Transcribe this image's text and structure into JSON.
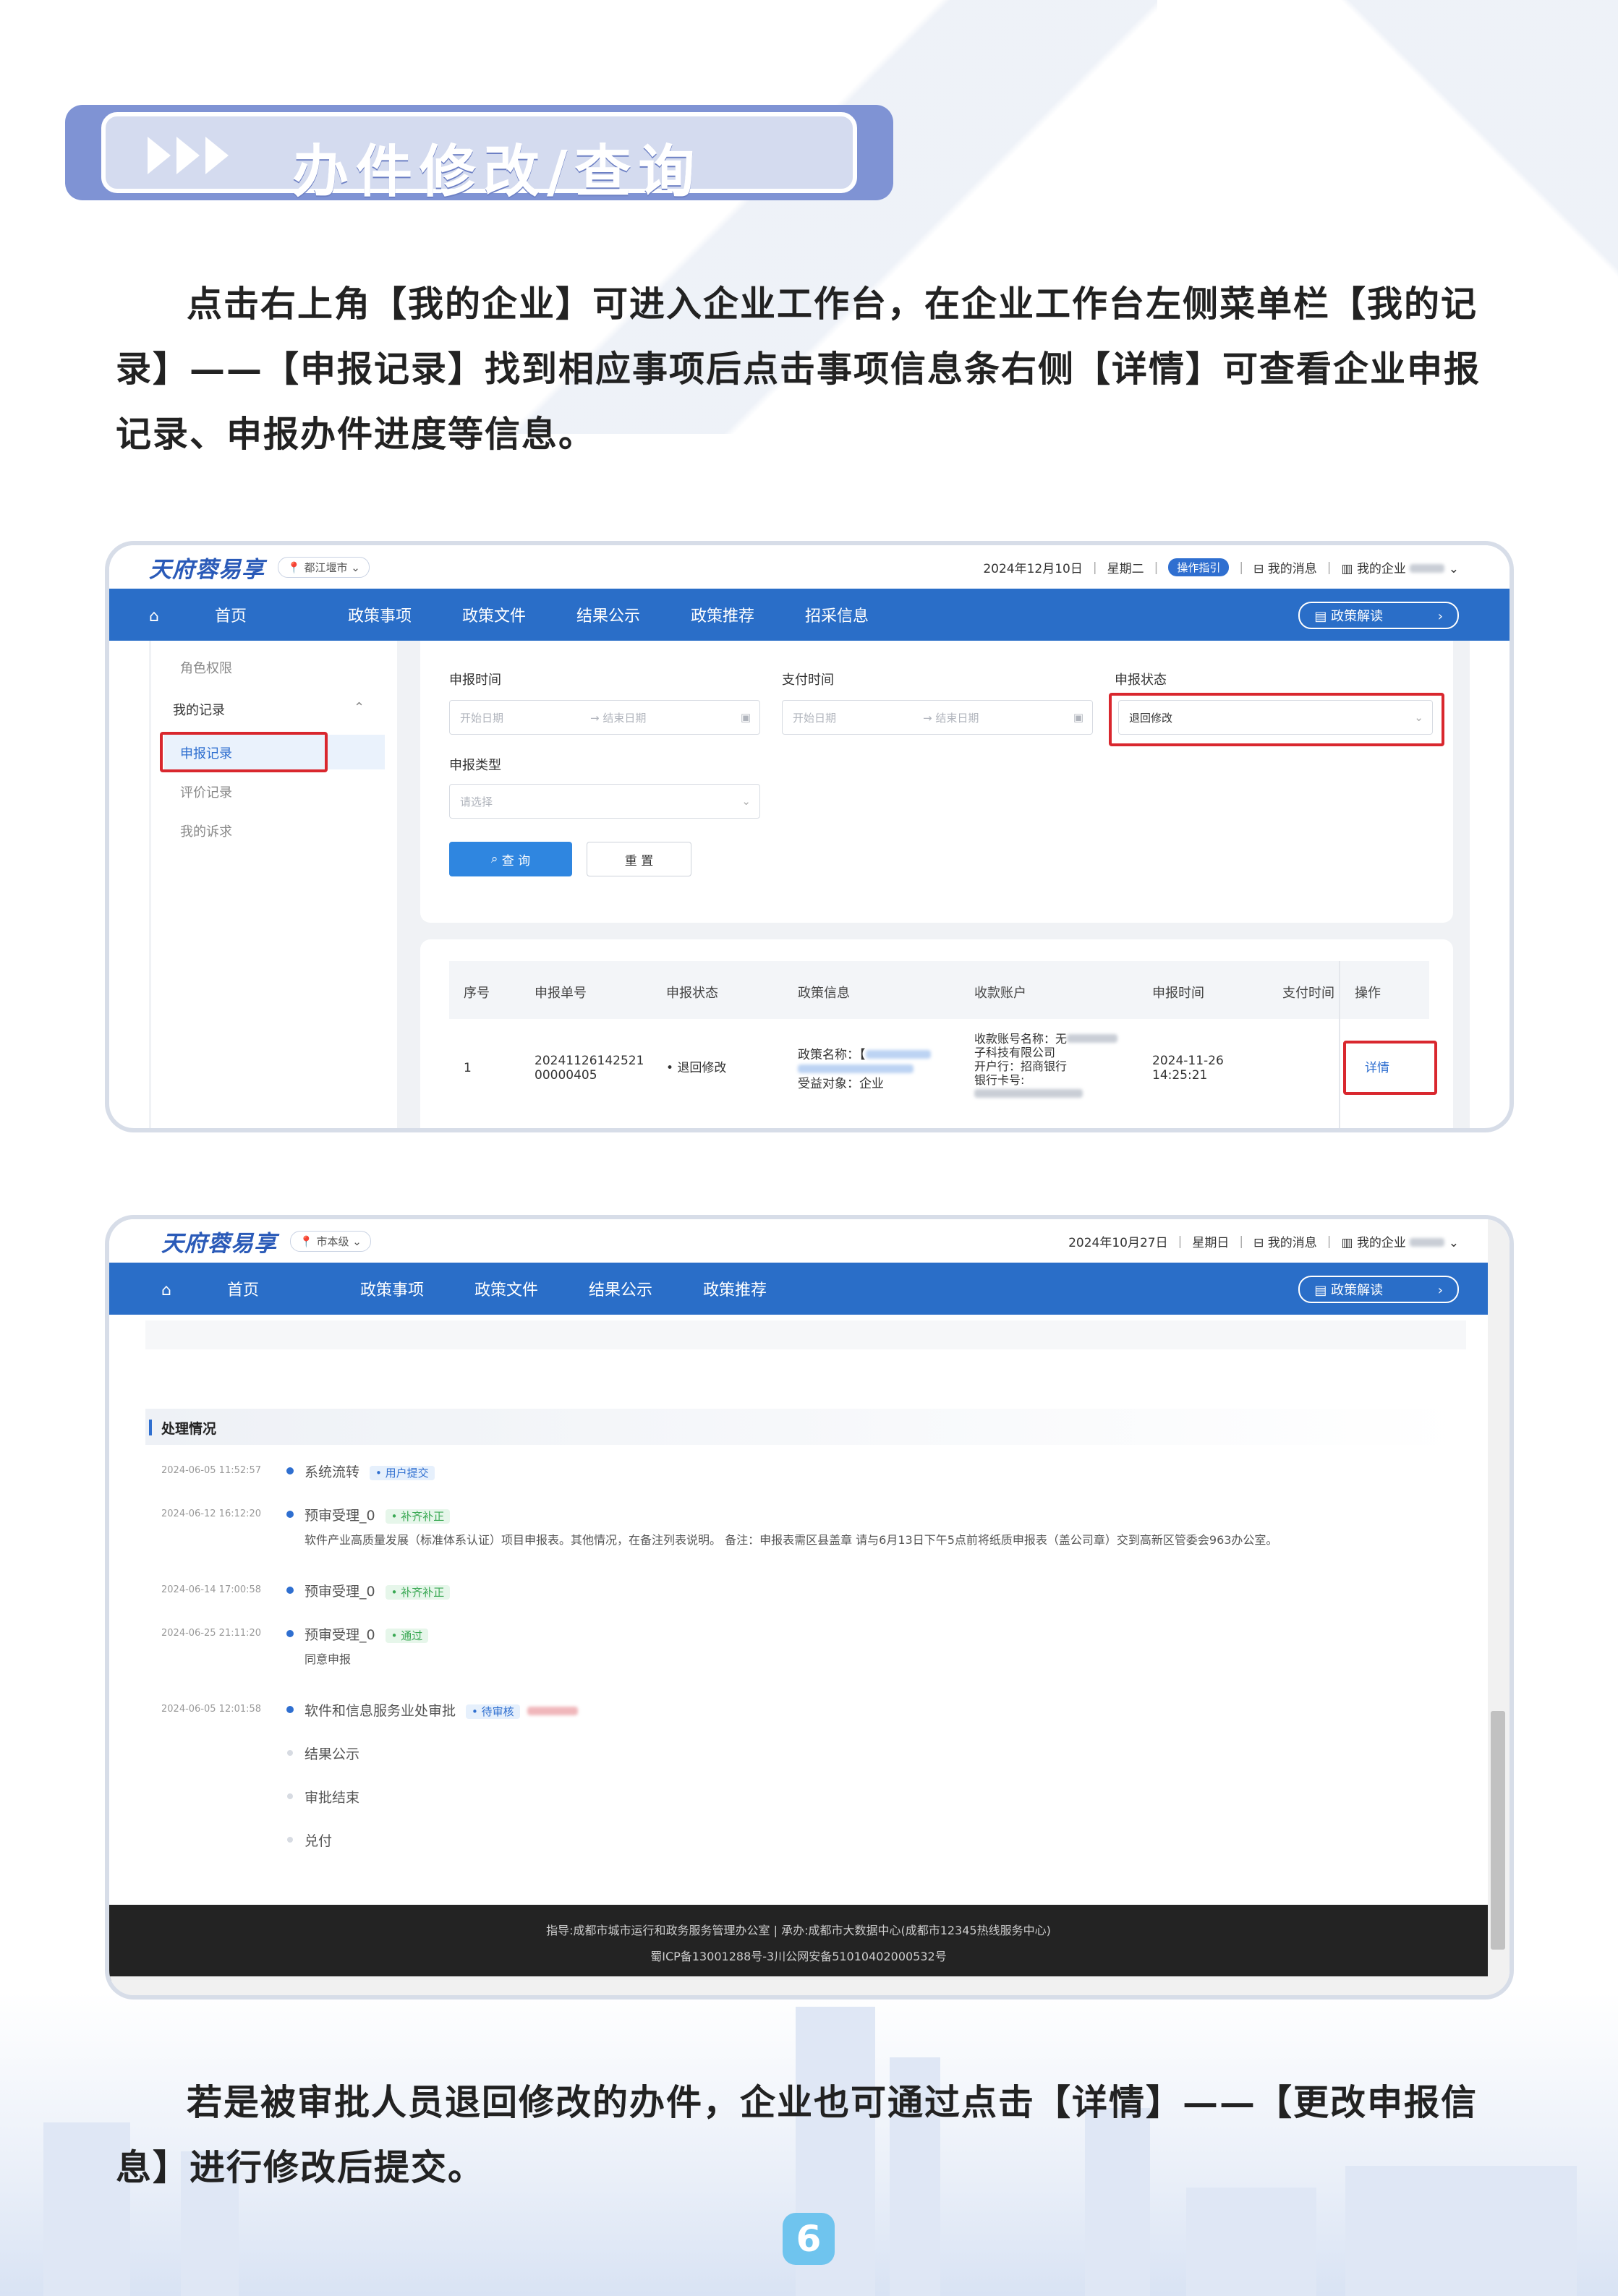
{
  "heading": {
    "title": "办件修改/查询"
  },
  "intro_paragraph": "点击右上角【我的企业】可进入企业工作台，在企业工作台左侧菜单栏【我的记录】——【申报记录】找到相应事项后点击事项信息条右侧【详情】可查看企业申报记录、申报办件进度等信息。",
  "closing_paragraph": "若是被审批人员退回修改的办件，企业也可通过点击【详情】——【更改申报信息】进行修改后提交。",
  "page_number": "6",
  "shot1": {
    "logo": "天府蓉易享",
    "location": "都江堰市",
    "date": "2024年12月10日",
    "weekday": "星期二",
    "guide": "操作指引",
    "messages": "我的消息",
    "my_company": "我的企业",
    "nav": [
      "首页",
      "政策事项",
      "政策文件",
      "结果公示",
      "政策推荐",
      "招采信息"
    ],
    "nav_button": "政策解读",
    "menu": {
      "role": "角色权限",
      "my_records": "我的记录",
      "apply_records": "申报记录",
      "eval_records": "评价记录",
      "appeals": "我的诉求"
    },
    "filters": {
      "apply_time": "申报时间",
      "pay_time": "支付时间",
      "apply_status": "申报状态",
      "start": "开始日期",
      "end": "结束日期",
      "status_value": "退回修改",
      "apply_type": "申报类型",
      "type_placeholder": "请选择",
      "search": "查 询",
      "reset": "重 置"
    },
    "table": {
      "headers": [
        "序号",
        "申报单号",
        "申报状态",
        "政策信息",
        "收款账户",
        "申报时间",
        "支付时间",
        "操作"
      ],
      "row": {
        "index": "1",
        "number_line1": "20241126142521",
        "number_line2": "00000405",
        "status": "退回修改",
        "policy_name_label": "政策名称：【",
        "beneficiary": "受益对象：企业",
        "acct_name": "收款账号名称：无",
        "acct_company": "子科技有限公司",
        "bank": "开户行：招商银行",
        "card": "银行卡号:",
        "date": "2024-11-26",
        "time": "14:25:21",
        "detail": "详情"
      }
    }
  },
  "shot2": {
    "logo": "天府蓉易享",
    "location": "市本级",
    "date": "2024年10月27日",
    "weekday": "星期日",
    "messages": "我的消息",
    "my_company": "我的企业",
    "nav": [
      "首页",
      "政策事项",
      "政策文件",
      "结果公示",
      "政策推荐"
    ],
    "nav_button": "政策解读",
    "section": "处理情况",
    "timeline": [
      {
        "date": "2024-06-05 11:52:57",
        "step": "系统流转",
        "tag": "用户提交",
        "tag_type": "b"
      },
      {
        "date": "2024-06-12 16:12:20",
        "step": "预审受理_0",
        "tag": "补齐补正",
        "tag_type": "g",
        "note": "软件产业高质量发展（标准体系认证）项目申报表。其他情况，在备注列表说明。 备注：申报表需区县盖章 请与6月13日下午5点前将纸质申报表（盖公司章）交到高新区管委会963办公室。"
      },
      {
        "date": "2024-06-14 17:00:58",
        "step": "预审受理_0",
        "tag": "补齐补正",
        "tag_type": "g"
      },
      {
        "date": "2024-06-25 21:11:20",
        "step": "预审受理_0",
        "tag": "通过",
        "tag_type": "g",
        "note": "同意申报"
      },
      {
        "date": "2024-06-05 12:01:58",
        "step": "软件和信息服务业处审批",
        "tag": "待审核",
        "tag_type": "b"
      }
    ],
    "pending": [
      "结果公示",
      "审批结束",
      "兑付"
    ],
    "footer_line1": "指导:成都市城市运行和政务服务管理办公室 | 承办:成都市大数据中心(成都市12345热线服务中心)",
    "footer_line2": "蜀ICP备13001288号-3川公网安备51010402000532号"
  }
}
